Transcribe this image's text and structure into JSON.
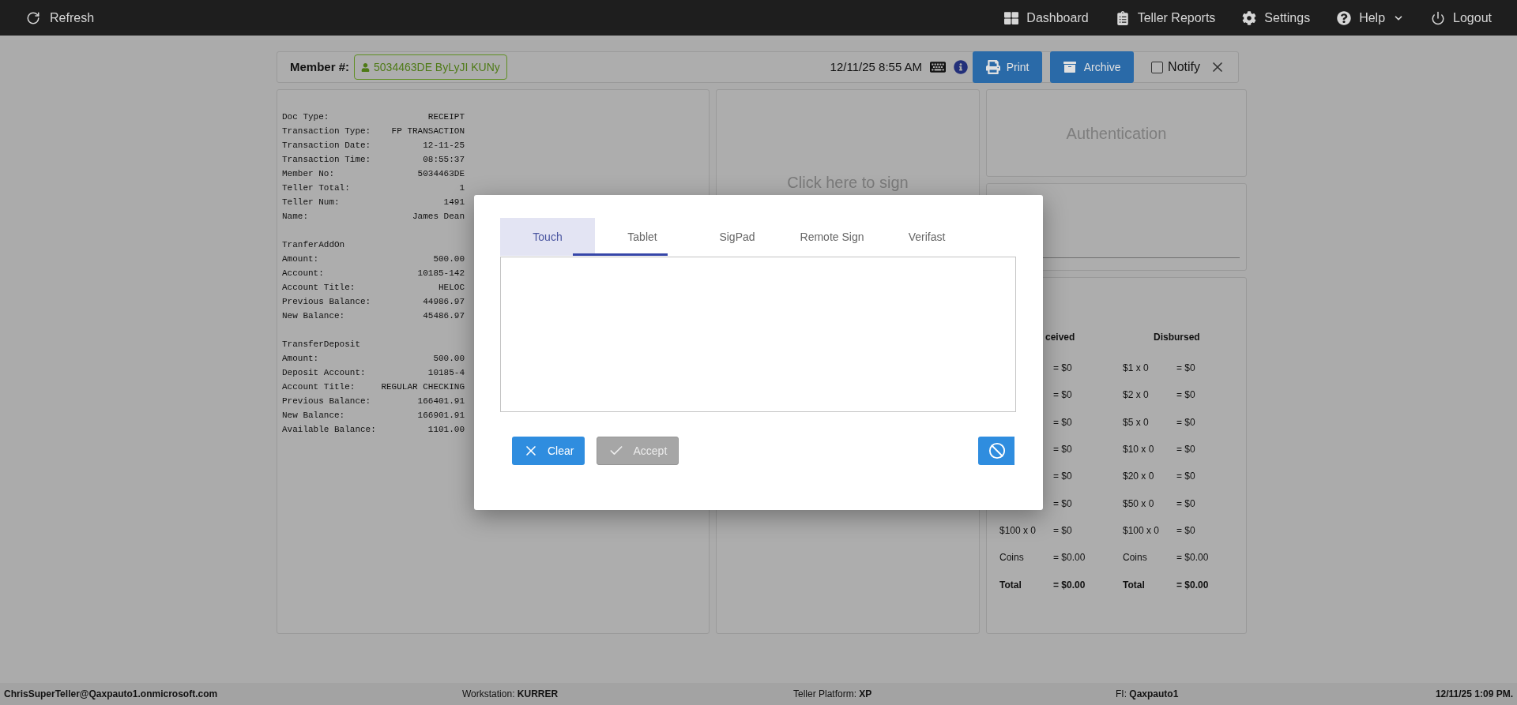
{
  "nav": {
    "refresh": {
      "label": "Refresh"
    },
    "items": [
      {
        "label": "Dashboard",
        "has_menu": false
      },
      {
        "label": "Teller Reports",
        "has_menu": false
      },
      {
        "label": "Settings",
        "has_menu": false
      },
      {
        "label": "Help",
        "has_menu": true
      },
      {
        "label": "Logout",
        "has_menu": false
      }
    ]
  },
  "member_bar": {
    "label": "Member #:",
    "member": "5034463DE ByLyJI KUNy",
    "datetime": "12/11/25 8:55 AM",
    "print": "Print",
    "archive": "Archive",
    "notify": {
      "label": "Notify",
      "checked": false
    }
  },
  "receipt": {
    "sections": [
      {
        "lines": [
          {
            "label": "Doc Type:",
            "value": "RECEIPT"
          },
          {
            "label": "Transaction Type:",
            "value": "FP TRANSACTION"
          },
          {
            "label": "Transaction Date:",
            "value": "12-11-25"
          },
          {
            "label": "Transaction Time:",
            "value": "08:55:37"
          },
          {
            "label": "Member No:",
            "value": "5034463DE"
          },
          {
            "label": "Teller Total:",
            "value": "1"
          },
          {
            "label": "Teller Num:",
            "value": "1491"
          },
          {
            "label": "Name:",
            "value": "James Dean"
          }
        ]
      },
      {
        "heading": "TranferAddOn",
        "lines": [
          {
            "label": "Amount:",
            "value": "500.00"
          },
          {
            "label": "Account:",
            "value": "10185-142"
          },
          {
            "label": "Account Title:",
            "value": "HELOC"
          },
          {
            "label": "Previous Balance:",
            "value": "44986.97"
          },
          {
            "label": "New Balance:",
            "value": "45486.97"
          }
        ]
      },
      {
        "heading": "TransferDeposit",
        "lines": [
          {
            "label": "Amount:",
            "value": "500.00"
          },
          {
            "label": "Deposit Account:",
            "value": "10185-4"
          },
          {
            "label": "Account Title:",
            "value": "REGULAR CHECKING"
          },
          {
            "label": "Previous Balance:",
            "value": "166401.91"
          },
          {
            "label": "New Balance:",
            "value": "166901.91"
          },
          {
            "label": "Available Balance:",
            "value": "1101.00"
          }
        ]
      }
    ]
  },
  "signature_panel": {
    "prompt": "Click here to sign"
  },
  "authentication": {
    "title": "Authentication"
  },
  "cash": {
    "received_header": "ceived",
    "disbursed_header": "Disbursed",
    "rows": [
      {
        "kind": "denomination",
        "received_amount": "= $0",
        "disbursed_label": "$1 x 0",
        "disbursed_amount": "= $0"
      },
      {
        "kind": "denomination",
        "received_amount": "= $0",
        "disbursed_label": "$2 x 0",
        "disbursed_amount": "= $0"
      },
      {
        "kind": "denomination",
        "received_amount": "= $0",
        "disbursed_label": "$5 x 0",
        "disbursed_amount": "= $0"
      },
      {
        "kind": "denomination",
        "received_amount": "= $0",
        "disbursed_label": "$10 x 0",
        "disbursed_amount": "= $0"
      },
      {
        "kind": "denomination",
        "received_amount": "= $0",
        "disbursed_label": "$20 x 0",
        "disbursed_amount": "= $0"
      },
      {
        "kind": "denomination",
        "received_amount": "= $0",
        "disbursed_label": "$50 x 0",
        "disbursed_amount": "= $0"
      },
      {
        "kind": "denomination",
        "received_label": "$100 x 0",
        "received_amount": "= $0",
        "disbursed_label": "$100 x 0",
        "disbursed_amount": "= $0"
      },
      {
        "kind": "coins",
        "received_label": "Coins",
        "received_amount": "= $0.00",
        "disbursed_label": "Coins",
        "disbursed_amount": "= $0.00"
      },
      {
        "kind": "total",
        "received_label": "Total",
        "received_amount": "= $0.00",
        "disbursed_label": "Total",
        "disbursed_amount": "= $0.00"
      }
    ]
  },
  "signature_dialog": {
    "tabs": [
      {
        "label": "Touch",
        "selected": true
      },
      {
        "label": "Tablet",
        "selected": false
      },
      {
        "label": "SigPad",
        "selected": false
      },
      {
        "label": "Remote Sign",
        "selected": false
      },
      {
        "label": "Verifast",
        "selected": false
      }
    ],
    "buttons": [
      {
        "kind": "clear",
        "label": "Clear",
        "disabled": false
      },
      {
        "kind": "accept",
        "label": "Accept",
        "disabled": true
      }
    ],
    "cancel_button": {
      "kind": "cancel"
    }
  },
  "status_bar": [
    {
      "text": "ChrisSuperTeller@Qaxpauto1.onmicrosoft.com",
      "bold": true
    },
    {
      "text": "Workstation: **KURRER**",
      "bold": false
    },
    {
      "text": "Teller Platform: **XP**",
      "bold": false
    },
    {
      "text": "FI: **Qaxpauto1**",
      "bold": false
    },
    {
      "text": "12/11/25 1:09 PM.",
      "bold": true
    }
  ]
}
